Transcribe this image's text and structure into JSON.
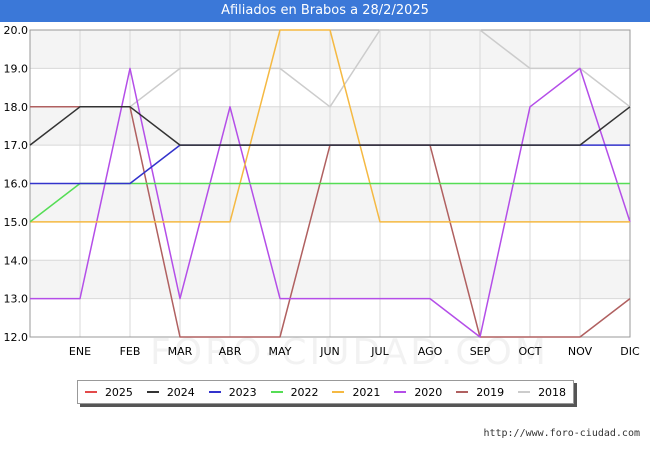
{
  "title": "Afiliados en Brabos a 28/2/2025",
  "footer_url": "http://www.foro-ciudad.com",
  "watermark": "FORO-CIUDAD.COM",
  "chart_data": {
    "type": "line",
    "categories": [
      "",
      "ENE",
      "FEB",
      "MAR",
      "ABR",
      "MAY",
      "JUN",
      "JUL",
      "AGO",
      "SEP",
      "OCT",
      "NOV",
      "DIC"
    ],
    "ylim": [
      12.0,
      20.0
    ],
    "yticks": [
      "12.0",
      "13.0",
      "14.0",
      "15.0",
      "16.0",
      "17.0",
      "18.0",
      "19.0",
      "20.0"
    ],
    "grid": true,
    "legend_position": "bottom",
    "series": [
      {
        "name": "2025",
        "color": "#e34a4a",
        "values": []
      },
      {
        "name": "2024",
        "color": "#333333",
        "values": [
          17,
          18,
          18,
          17,
          17,
          17,
          17,
          17,
          17,
          17,
          17,
          17,
          18
        ]
      },
      {
        "name": "2023",
        "color": "#3333cc",
        "values": [
          16,
          16,
          16,
          17,
          17,
          17,
          17,
          17,
          17,
          17,
          17,
          17,
          17
        ]
      },
      {
        "name": "2022",
        "color": "#55dd55",
        "values": [
          15,
          16,
          16,
          16,
          16,
          16,
          16,
          16,
          16,
          16,
          16,
          16,
          16
        ]
      },
      {
        "name": "2021",
        "color": "#f5b942",
        "values": [
          15,
          15,
          15,
          15,
          15,
          20,
          20,
          15,
          15,
          15,
          15,
          15,
          15
        ]
      },
      {
        "name": "2020",
        "color": "#b44ee8",
        "values": [
          13,
          13,
          19,
          13,
          18,
          13,
          13,
          13,
          13,
          12,
          18,
          19,
          15
        ]
      },
      {
        "name": "2019",
        "color": "#b06060",
        "values": [
          18,
          18,
          18,
          12,
          12,
          12,
          17,
          17,
          17,
          12,
          12,
          12,
          13
        ]
      },
      {
        "name": "2018",
        "color": "#cccccc",
        "values": [
          null,
          null,
          18,
          19,
          19,
          19,
          18,
          20,
          20,
          20,
          19,
          19,
          18
        ]
      }
    ]
  }
}
